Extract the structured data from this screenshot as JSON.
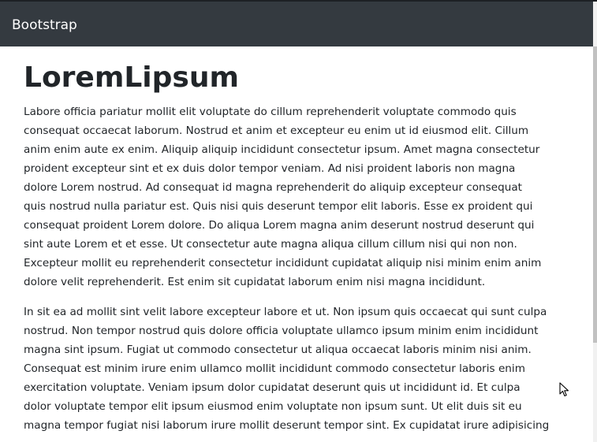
{
  "navbar": {
    "brand": "Bootstrap"
  },
  "main": {
    "title": "LoremLipsum",
    "paragraphs": [
      {
        "lines": [
          "Labore officia pariatur mollit elit voluptate do cillum reprehenderit voluptate commodo quis",
          "consequat occaecat laborum. Nostrud et anim et excepteur eu enim ut id eiusmod elit. Cillum",
          "anim enim aute ex enim. Aliquip aliquip incididunt consectetur ipsum. Amet magna consectetur",
          "proident excepteur sint et ex duis dolor tempor veniam. Ad nisi proident laboris non magna",
          "dolore Lorem nostrud. Ad consequat id magna reprehenderit do aliquip excepteur consequat",
          "quis nostrud nulla pariatur est. Quis nisi quis deserunt tempor elit laboris. Esse ex proident qui",
          "consequat proident Lorem dolore. Do aliqua Lorem magna anim deserunt nostrud deserunt qui",
          "sint aute Lorem et et esse. Ut consectetur aute magna aliqua cillum cillum nisi qui non non.",
          "Excepteur mollit eu reprehenderit consectetur incididunt cupidatat aliquip nisi minim enim anim",
          "dolore velit reprehenderit. Est enim sit cupidatat laborum enim nisi magna incididunt."
        ]
      },
      {
        "lines": [
          "In sit ea ad mollit sint velit labore excepteur labore et ut. Non ipsum quis occaecat qui sunt culpa",
          "nostrud. Non tempor nostrud quis dolore officia voluptate ullamco ipsum minim enim incididunt",
          "magna sint ipsum. Fugiat ut commodo consectetur ut aliqua occaecat laboris minim nisi anim.",
          "Consequat est minim irure enim ullamco mollit incididunt commodo consectetur laboris enim",
          "exercitation voluptate. Veniam ipsum dolor cupidatat deserunt quis ut incididunt id. Et culpa",
          "dolor voluptate tempor elit ipsum eiusmod enim voluptate non ipsum sunt. Ut elit duis sit eu",
          "magna tempor fugiat nisi laborum irure mollit deserunt tempor sint. Ex cupidatat irure adipisicing"
        ]
      }
    ]
  },
  "icons": {
    "cursor": "mouse-pointer-icon"
  },
  "colors": {
    "navbar_bg": "#343a40",
    "navbar_text": "#ffffff",
    "body_text": "#212529",
    "page_bg": "#ffffff"
  }
}
